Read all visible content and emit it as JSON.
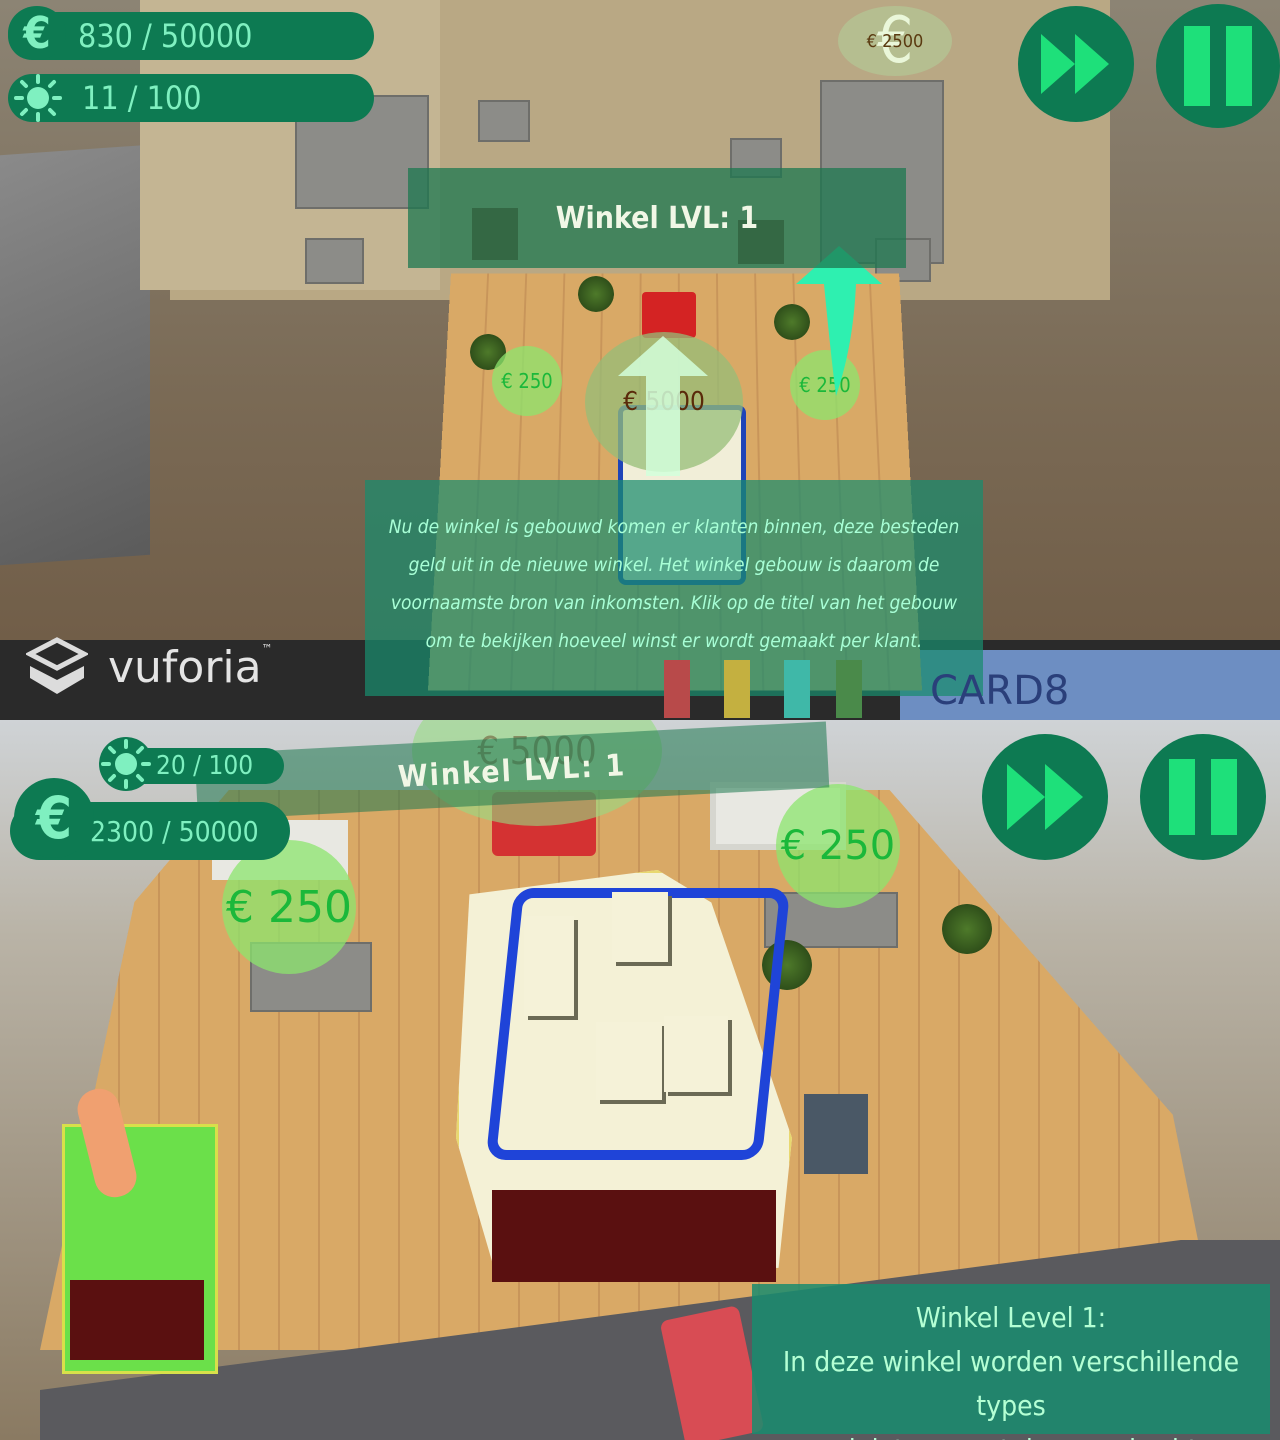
{
  "top_view": {
    "money": {
      "icon": "€",
      "value": "830 / 50000"
    },
    "population": {
      "value": "11 / 100"
    },
    "building_title": "Winkel LVL: 1",
    "plot_price_far": "€ 2500",
    "plot_price_far_icon": "€",
    "center_price": "€ 5000",
    "left_price": "€ 250",
    "right_price": "€ 250",
    "info_text": "Nu de winkel is gebouwd komen er klanten binnen, deze besteden geld uit in de nieuwe winkel. Het winkel gebouw is daarom de voornaamste bron van inkomsten. Klik op de titel van het gebouw om te bekijken hoeveel winst er wordt gemaakt per klant.",
    "watermark": "vuforia",
    "watermark_tm": "™",
    "card_label": "CARD8"
  },
  "bottom_view": {
    "population": {
      "value": "20 / 100"
    },
    "money": {
      "icon": "€",
      "value": "2300 / 50000"
    },
    "building_title": "Winkel LVL: 1",
    "center_price": "€ 5000",
    "left_price": "€ 250",
    "right_price": "€ 250",
    "info_title": "Winkel Level 1:",
    "info_line1": "In deze winkel worden verschillende types",
    "info_line2": "miniatuur voetuigen verkocht"
  },
  "icons": {
    "money": "euro-icon",
    "population": "sun-icon",
    "fast_forward": "fast-forward-icon",
    "pause": "pause-icon"
  },
  "colors": {
    "hud_green": "#0d7a52",
    "hud_text": "#7ff0c0",
    "button_glyph": "#1ee07a",
    "price_text": "#1bb83a"
  }
}
